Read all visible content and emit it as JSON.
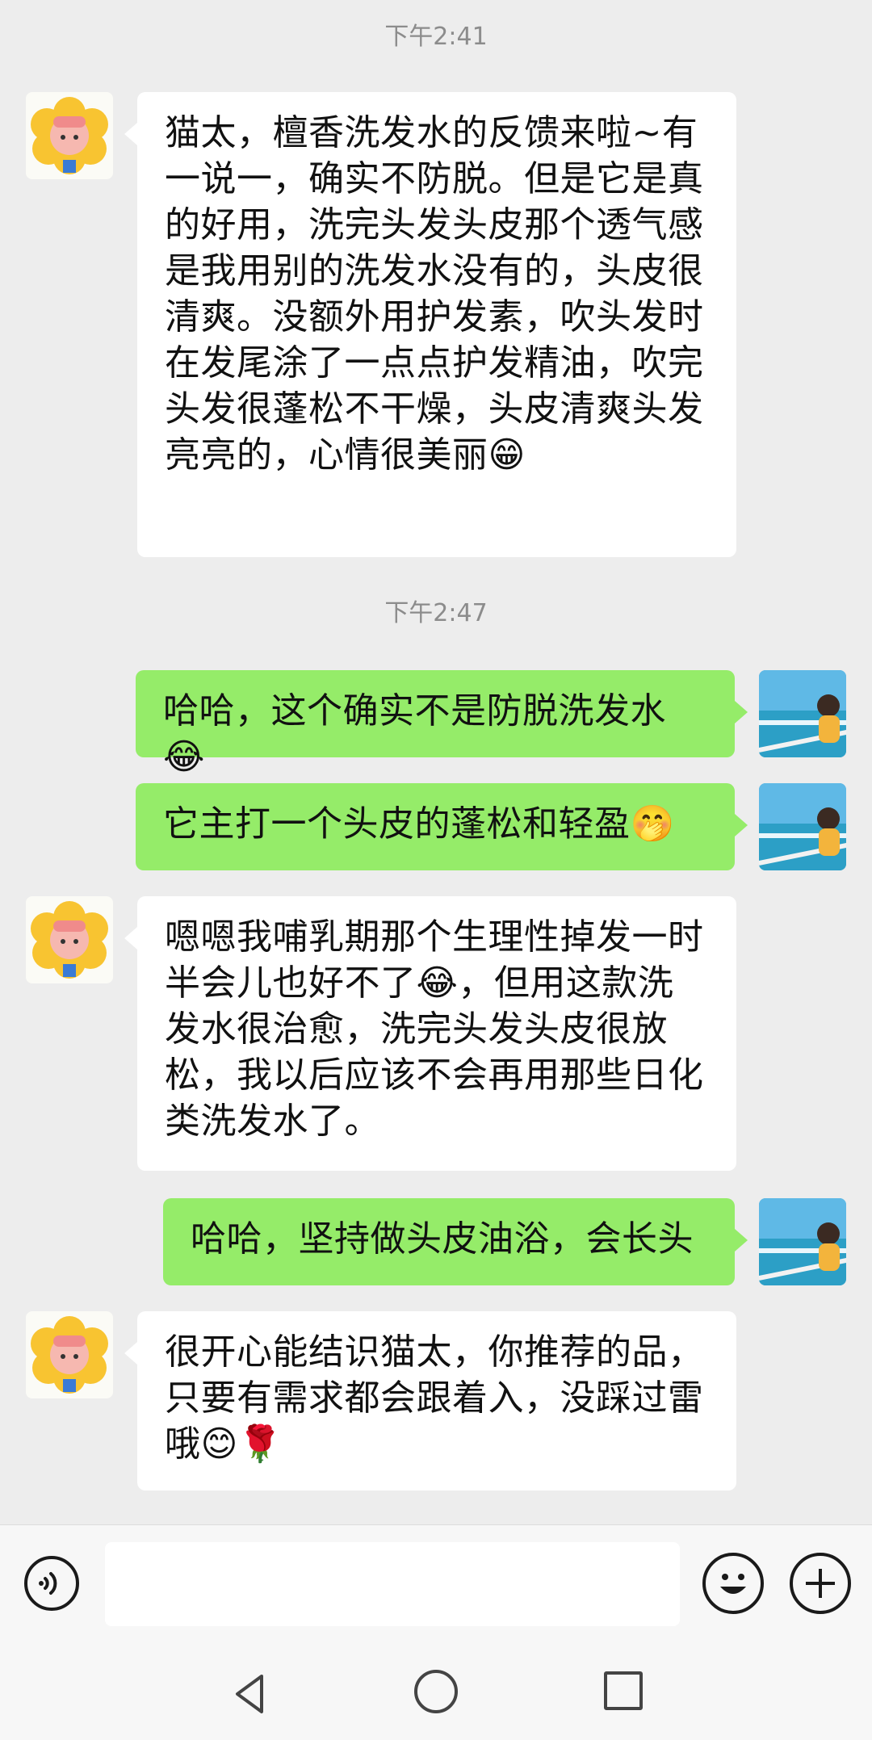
{
  "timestamps": {
    "t1": "下午2:41",
    "t2": "下午2:47"
  },
  "messages": [
    {
      "sender": "them",
      "text": "猫太，檀香洗发水的反馈来啦~有一说一，确实不防脱。但是它是真的好用，洗完头发头皮那个透气感是我用别的洗发水没有的，头皮很清爽。没额外用护发素，吹头发时在发尾涂了一点点护发精油，吹完头发很蓬松不干燥，头皮清爽头发亮亮的，心情很美丽😁"
    },
    {
      "sender": "me",
      "text": "哈哈，这个确实不是防脱洗发水😂"
    },
    {
      "sender": "me",
      "text": "它主打一个头皮的蓬松和轻盈🤭"
    },
    {
      "sender": "them",
      "text": "嗯嗯我哺乳期那个生理性掉发一时半会儿也好不了😂，但用这款洗发水很治愈，洗完头发头皮很放松，我以后应该不会再用那些日化类洗发水了。"
    },
    {
      "sender": "me",
      "text": "哈哈，坚持做头皮油浴，会长头"
    },
    {
      "sender": "them",
      "text": "很开心能结识猫太，你推荐的品，只要有需求都会跟着入，没踩过雷哦😊🌹"
    }
  ],
  "input_bar": {
    "placeholder": "",
    "value": "",
    "voice_icon": "voice-icon",
    "emoji_icon": "emoji-icon",
    "plus_icon": "plus-icon"
  },
  "colors": {
    "background": "#ededed",
    "bubble_me": "#95ec69",
    "bubble_them": "#ffffff",
    "timestamp": "#8c8c8c"
  }
}
